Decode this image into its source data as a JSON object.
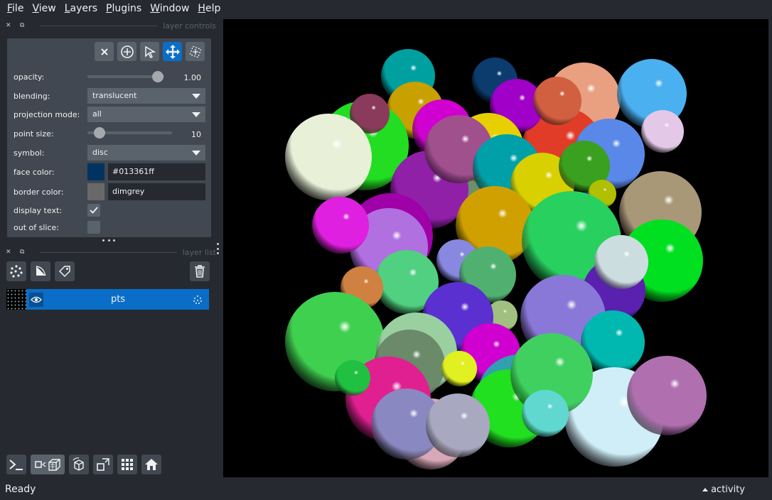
{
  "menu": {
    "file": {
      "u": "F",
      "rest": "ile"
    },
    "view": {
      "u": "V",
      "rest": "iew"
    },
    "layers": {
      "u": "L",
      "rest": "ayers"
    },
    "plugins": {
      "u": "P",
      "rest": "lugins"
    },
    "window": {
      "u": "W",
      "rest": "indow"
    },
    "help": {
      "u": "H",
      "rest": "elp"
    }
  },
  "layer_controls": {
    "title": "layer controls",
    "opacity": {
      "label": "opacity:",
      "value": "1.00",
      "fraction": 1.0
    },
    "blending": {
      "label": "blending:",
      "value": "translucent"
    },
    "projection_mode": {
      "label": "projection mode:",
      "value": "all"
    },
    "point_size": {
      "label": "point size:",
      "value": "10"
    },
    "symbol": {
      "label": "symbol:",
      "value": "disc"
    },
    "face_color": {
      "label": "face color:",
      "value": "#013361ff",
      "swatch": "#013361"
    },
    "border_color": {
      "label": "border color:",
      "value": "dimgrey",
      "swatch": "#696969"
    },
    "display_text": {
      "label": "display text:",
      "checked": true
    },
    "out_of_slice": {
      "label": "out of slice:",
      "checked": false
    }
  },
  "layer_list": {
    "title": "layer list",
    "layers": [
      {
        "name": "pts",
        "visible": true,
        "selected": true
      }
    ]
  },
  "status": {
    "text": "Ready",
    "activity": "activity"
  },
  "colors": {
    "accent": "#0a6ec8",
    "panel": "#414851",
    "background": "#262930"
  }
}
